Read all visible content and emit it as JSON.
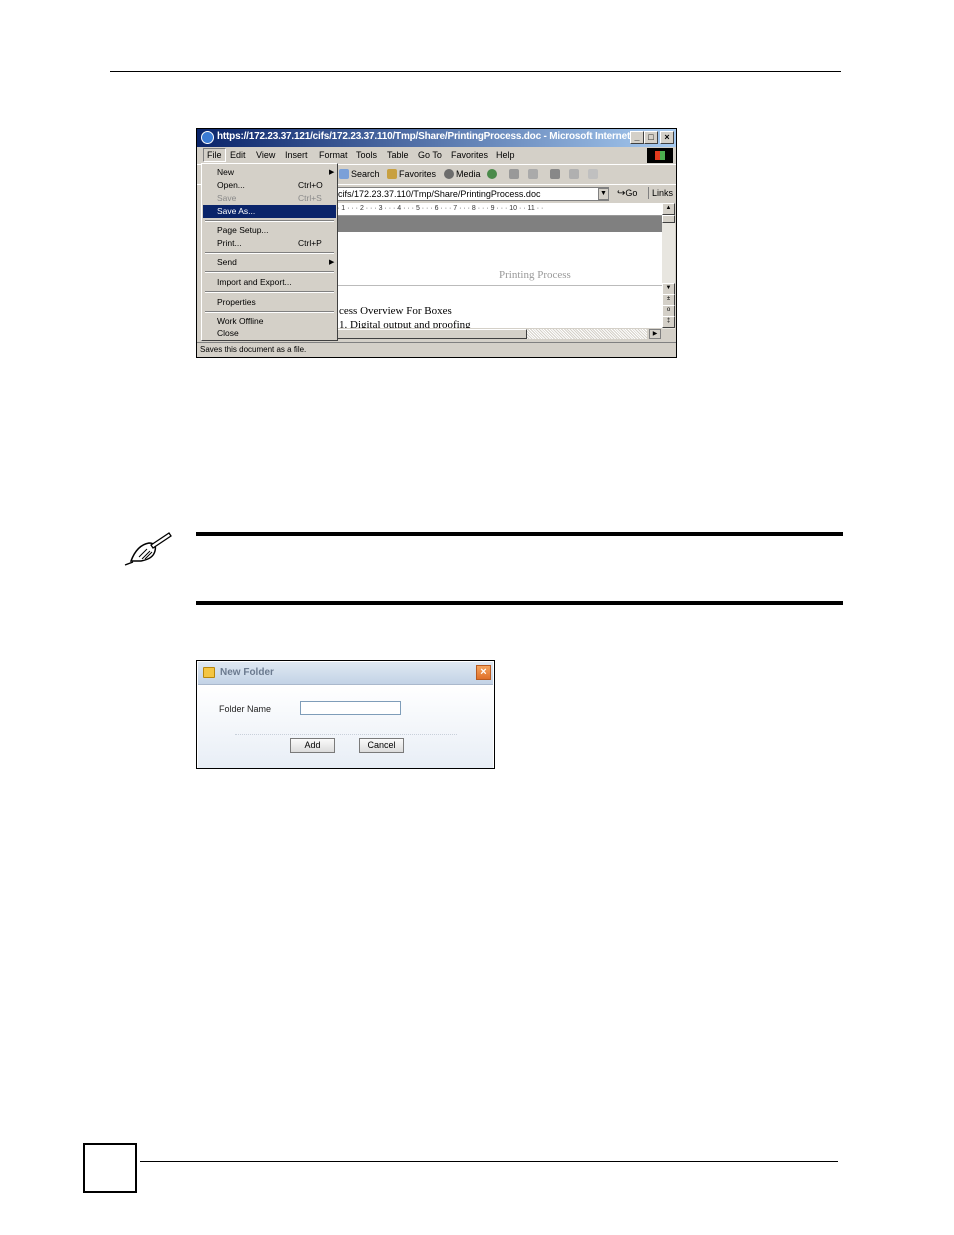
{
  "ie_window": {
    "title": "https://172.23.37.121/cifs/172.23.37.110/Tmp/Share/PrintingProcess.doc - Microsoft Internet E...",
    "title_buttons": [
      "_",
      "□",
      "×"
    ],
    "menubar": [
      "File",
      "Edit",
      "View",
      "Insert",
      "Format",
      "Tools",
      "Table",
      "Go To",
      "Favorites",
      "Help"
    ],
    "toolbar": {
      "search": "Search",
      "favorites": "Favorites",
      "media": "Media"
    },
    "address": "cifs/172.23.37.110/Tmp/Share/PrintingProcess.doc",
    "go": "Go",
    "links": "Links",
    "ruler": "· 1 · · · 2 · · · 3 · · · 4 · · · 5 · · · 6 · · · 7 · · · 8 · · · 9 · · · 10 · · 11 · ·",
    "doc": {
      "header": "Printing Process",
      "line1": "cess Overview For Boxes",
      "line2": "1.    Digital output and proofing"
    },
    "status": "Saves this document as a file.",
    "file_menu": [
      {
        "label": "New",
        "shortcut": "",
        "submenu": true
      },
      {
        "label": "Open...",
        "shortcut": "Ctrl+O",
        "submenu": false
      },
      {
        "label": "Save",
        "shortcut": "Ctrl+S",
        "submenu": false,
        "disabled": true
      },
      {
        "label": "Save As...",
        "shortcut": "",
        "submenu": false,
        "selected": true
      },
      {
        "label": "Page Setup...",
        "shortcut": "",
        "submenu": false
      },
      {
        "label": "Print...",
        "shortcut": "Ctrl+P",
        "submenu": false
      },
      {
        "label": "Send",
        "shortcut": "",
        "submenu": true
      },
      {
        "label": "Import and Export...",
        "shortcut": "",
        "submenu": false
      },
      {
        "label": "Properties",
        "shortcut": "",
        "submenu": false
      },
      {
        "label": "Work Offline",
        "shortcut": "",
        "submenu": false
      },
      {
        "label": "Close",
        "shortcut": "",
        "submenu": false
      }
    ]
  },
  "folder_dialog": {
    "title": "New Folder",
    "close": "×",
    "field_label": "Folder Name",
    "field_value": "",
    "add_button": "Add",
    "cancel_button": "Cancel"
  },
  "icons": {
    "note": "note-pen-icon",
    "ie": "internet-explorer-icon",
    "folder": "new-folder-icon"
  },
  "colors": {
    "title_bar": "#0a246a",
    "menu_highlight": "#0a246a",
    "window_face": "#d4d0c8",
    "dialog_close": "#e0702a"
  }
}
